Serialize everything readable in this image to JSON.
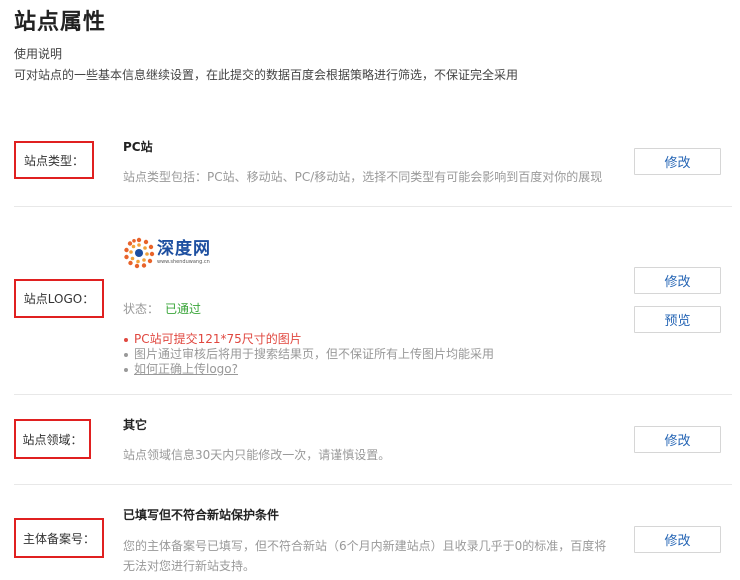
{
  "page": {
    "title": "站点属性",
    "usage_title": "使用说明",
    "usage_desc": "可对站点的一些基本信息继续设置，在此提交的数据百度会根据策略进行筛选，不保证完全采用"
  },
  "site_type": {
    "label": "站点类型：",
    "value": "PC站",
    "desc": "站点类型包括：PC站、移动站、PC/移动站，选择不同类型有可能会影响到百度对你的展现",
    "edit_label": "修改"
  },
  "site_logo": {
    "label": "站点LOGO：",
    "logo_name": "深度网",
    "logo_url": "www.shenduwang.cn",
    "status_label": "状态：",
    "status_value": "已通过",
    "tips": [
      "PC站可提交121*75尺寸的图片",
      "图片通过审核后将用于搜索结果页，但不保证所有上传图片均能采用",
      "如何正确上传logo?"
    ],
    "edit_label": "修改",
    "preview_label": "预览"
  },
  "site_domain": {
    "label": "站点领域：",
    "value": "其它",
    "desc": "站点领域信息30天内只能修改一次，请谨慎设置。",
    "edit_label": "修改"
  },
  "icp": {
    "label": "主体备案号：",
    "value": "已填写但不符合新站保护条件",
    "desc_line1": "您的主体备案号已填写，但不符合新站（6个月内新建站点）且收录几乎于0的标准，百度将",
    "desc_line2": "无法对您进行新站支持。",
    "edit_label": "修改"
  },
  "colors": {
    "highlight_border": "#e02020",
    "link_blue": "#2565b5",
    "status_green": "#3aa53a",
    "tip_red": "#e0473f"
  }
}
